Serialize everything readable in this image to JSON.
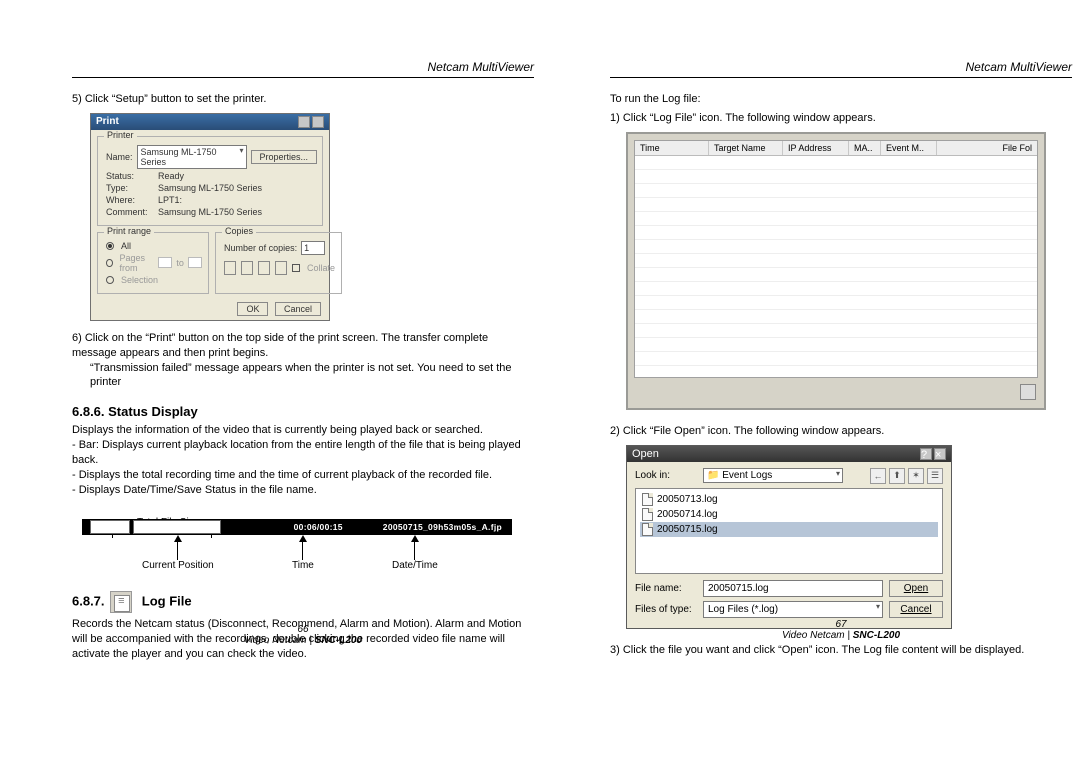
{
  "header": {
    "title": "Netcam MultiViewer"
  },
  "left": {
    "step5": "5) Click “Setup” button to set the printer.",
    "step6_1": "6)  Click on the “Print” button on the top side of the print screen. The transfer complete message appears and then print begins.",
    "step6_2": "“Transmission failed” message appears when the printer is not set. You need to set the printer",
    "sec686_title": "6.8.6. Status Display",
    "sec686_p1": "Displays the information of the video that is currently being played back or searched.",
    "sec686_p2": "- Bar: Displays current playback location from the entire length of the file that is being played back.",
    "sec686_p3": "- Displays the total recording time and the time of current playback of the recorded file.",
    "sec686_p4": "- Displays Date/Time/Save Status in the file name.",
    "status": {
      "total_file_size": "Total File Size",
      "time_text": "00:06/00:15",
      "filename_text": "20050715_09h53m05s_A.fjp",
      "lbl_curpos": "Current Position",
      "lbl_time": "Time",
      "lbl_datetime": "Date/Time"
    },
    "sec687_num": "6.8.7.",
    "sec687_title": "Log File",
    "sec687_body": "Records the Netcam status (Disconnect, Recommend, Alarm and Motion). Alarm and Motion will be accompanied with the recordings, double clicking the recorded video file name will activate the player and you can check the video."
  },
  "right": {
    "intro": "To run the Log file:",
    "step1": "1) Click “Log File” icon. The following window appears.",
    "step2": "2) Click “File Open” icon. The following window appears.",
    "step3": "3) Click the file you want and click “Open” icon. The Log file content will be displayed."
  },
  "log_window": {
    "headers": [
      "Time",
      "Target Name",
      "IP Address",
      "MA..",
      "Event M..",
      "File Fol"
    ]
  },
  "print_dialog": {
    "title": "Print",
    "grp_printer": "Printer",
    "name_lbl": "Name:",
    "name_val": "Samsung ML-1750 Series",
    "properties_btn": "Properties...",
    "status_lbl": "Status:",
    "status_val": "Ready",
    "type_lbl": "Type:",
    "type_val": "Samsung ML-1750 Series",
    "where_lbl": "Where:",
    "where_val": "LPT1:",
    "comment_lbl": "Comment:",
    "comment_val": "Samsung ML-1750 Series",
    "grp_range": "Print range",
    "range_all": "All",
    "range_pages": "Pages   from",
    "range_to": "to",
    "range_sel": "Selection",
    "grp_copies": "Copies",
    "copies_lbl": "Number of copies:",
    "copies_val": "1",
    "collate": "Collate",
    "ok": "OK",
    "cancel": "Cancel"
  },
  "open_dialog": {
    "title": "Open",
    "lookin_lbl": "Look in:",
    "lookin_val": "Event Logs",
    "files": [
      "20050713.log",
      "20050714.log",
      "20050715.log"
    ],
    "filename_lbl": "File name:",
    "filename_val": "20050715.log",
    "filetype_lbl": "Files of type:",
    "filetype_val": "Log Files (*.log)",
    "open_btn": "Open",
    "cancel_btn": "Cancel"
  },
  "footer": {
    "page_left": "66",
    "page_right": "67",
    "ref_a": "Video Netcam",
    "ref_b": "SNC-L200"
  }
}
